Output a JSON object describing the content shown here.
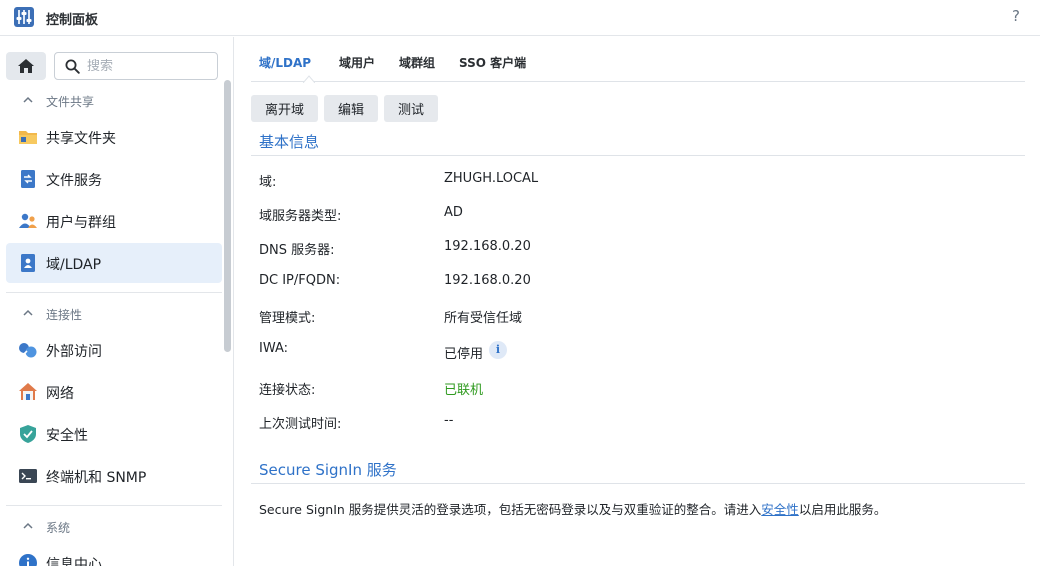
{
  "window": {
    "title": "控制面板",
    "help": "?"
  },
  "sidebar": {
    "search_placeholder": "搜索",
    "sections": [
      {
        "title": "文件共享",
        "items": [
          {
            "label": "共享文件夹",
            "icon": "folder-icon"
          },
          {
            "label": "文件服务",
            "icon": "file-services-icon"
          },
          {
            "label": "用户与群组",
            "icon": "users-icon"
          },
          {
            "label": "域/LDAP",
            "icon": "domain-ldap-icon",
            "active": true
          }
        ]
      },
      {
        "title": "连接性",
        "items": [
          {
            "label": "外部访问",
            "icon": "external-access-icon"
          },
          {
            "label": "网络",
            "icon": "network-house-icon"
          },
          {
            "label": "安全性",
            "icon": "security-shield-icon"
          },
          {
            "label": "终端机和 SNMP",
            "icon": "terminal-icon"
          }
        ]
      },
      {
        "title": "系统",
        "items": [
          {
            "label": "信息中心",
            "icon": "info-center-icon"
          }
        ]
      }
    ]
  },
  "main": {
    "tabs": [
      {
        "label": "域/LDAP",
        "active": true
      },
      {
        "label": "域用户"
      },
      {
        "label": "域群组"
      },
      {
        "label": "SSO 客户端"
      }
    ],
    "toolbar": {
      "leave": "离开域",
      "edit": "编辑",
      "test": "测试"
    },
    "basic_info": {
      "title": "基本信息",
      "rows": [
        {
          "label": "域:",
          "value": "ZHUGH.LOCAL"
        },
        {
          "label": "域服务器类型:",
          "value": "AD"
        },
        {
          "label": "DNS 服务器:",
          "value": "192.168.0.20"
        },
        {
          "label": "DC IP/FQDN:",
          "value": "192.168.0.20"
        },
        {
          "label": "管理模式:",
          "value": "所有受信任域"
        },
        {
          "label": "IWA:",
          "value": "已停用",
          "info": "i"
        },
        {
          "label": "连接状态:",
          "value": "已联机",
          "status_color": "#2f9a1f"
        },
        {
          "label": "上次测试时间:",
          "value": "--"
        }
      ]
    },
    "secure_signin": {
      "title": "Secure SignIn 服务",
      "desc_before": "Secure SignIn 服务提供灵活的登录选项，包括无密码登录以及与双重验证的整合。请进入",
      "desc_link": "安全性",
      "desc_after": "以启用此服务。"
    }
  },
  "colors": {
    "accent": "#2f72c8",
    "active_bg": "#e6effa",
    "button_bg": "#e6e9ed"
  }
}
